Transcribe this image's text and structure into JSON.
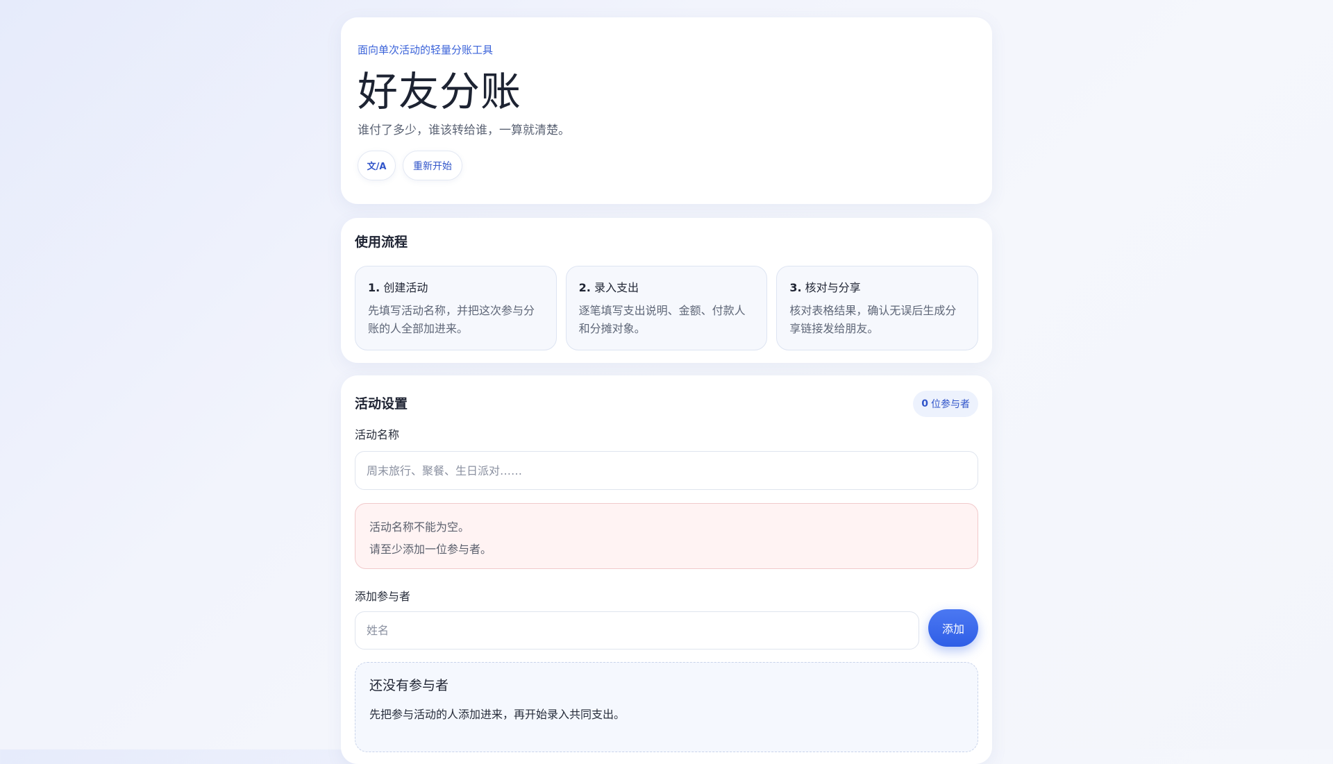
{
  "hero": {
    "eyebrow": "面向单次活动的轻量分账工具",
    "title": "好友分账",
    "subtitle": "谁付了多少，谁该转给谁，一算就清楚。",
    "lang_button": "文/A",
    "restart_button": "重新开始"
  },
  "flow": {
    "title": "使用流程",
    "steps": [
      {
        "num": "1.",
        "title": "创建活动",
        "desc": "先填写活动名称，并把这次参与分账的人全部加进来。"
      },
      {
        "num": "2.",
        "title": "录入支出",
        "desc": "逐笔填写支出说明、金额、付款人和分摊对象。"
      },
      {
        "num": "3.",
        "title": "核对与分享",
        "desc": "核对表格结果，确认无误后生成分享链接发给朋友。"
      }
    ]
  },
  "setup": {
    "title": "活动设置",
    "participant_count": "0",
    "participant_suffix": "位参与者",
    "activity_name_label": "活动名称",
    "activity_name_value": "",
    "activity_name_placeholder": "周末旅行、聚餐、生日派对……",
    "errors": [
      "活动名称不能为空。",
      "请至少添加一位参与者。"
    ],
    "add_participant_label": "添加参与者",
    "participant_name_value": "",
    "participant_name_placeholder": "姓名",
    "add_button": "添加",
    "empty_title": "还没有参与者",
    "empty_desc": "先把参与活动的人添加进来，再开始录入共同支出。"
  },
  "colors": {
    "accent": "#3054c9",
    "primary_button": "#2f5ee6",
    "error_bg": "#fff3f3"
  }
}
